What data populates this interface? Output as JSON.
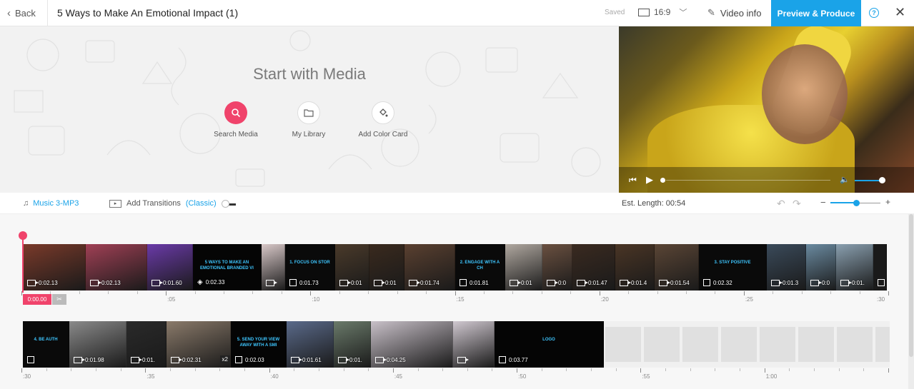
{
  "header": {
    "back_label": "Back",
    "title": "5 Ways to Make An Emotional Impact (1)",
    "saved_label": "Saved",
    "ratio_label": "16:9",
    "video_info_label": "Video info",
    "preview_label": "Preview & Produce",
    "help_icon": "?",
    "close_icon": "✕"
  },
  "media": {
    "title": "Start with Media",
    "options": [
      {
        "label": "Search Media",
        "icon": "search-icon"
      },
      {
        "label": "My Library",
        "icon": "folder-icon"
      },
      {
        "label": "Add Color Card",
        "icon": "paint-bucket-icon"
      }
    ]
  },
  "player": {
    "prev_icon": "⏮",
    "play_icon": "▶",
    "volume_icon": "🔈"
  },
  "toolbar": {
    "music_label": "Music 3-MP3",
    "transitions_label": "Add Transitions",
    "transitions_mode": "(Classic)",
    "est_length": "Est. Length: 00:54",
    "undo_icon": "↶",
    "redo_icon": "↷",
    "zoom_minus": "−",
    "zoom_plus": "+"
  },
  "playhead": {
    "time": "0:00.00"
  },
  "row1_clips": [
    {
      "kind": "video",
      "dur": "0:02.13",
      "bg": "#7a3a2a",
      "w": 88
    },
    {
      "kind": "video",
      "dur": "0:02.13",
      "bg": "#a04055",
      "w": 86
    },
    {
      "kind": "video",
      "dur": "0:01.60",
      "bg": "#6a3aa8",
      "w": 64
    },
    {
      "kind": "color",
      "dur": "0:02.33",
      "bg": "#050505",
      "w": 96,
      "headline": "5 WAYS TO MAKE AN EMOTIONAL BRANDED VI"
    },
    {
      "kind": "video",
      "dur": "",
      "bg": "#d8c8c8",
      "w": 33
    },
    {
      "kind": "image",
      "dur": "0:01.73",
      "bg": "#0a0a0a",
      "w": 70,
      "headline": "1. FOCUS ON STOR"
    },
    {
      "kind": "video",
      "dur": "0:01",
      "bg": "#4a3a2a",
      "w": 48
    },
    {
      "kind": "video",
      "dur": "0:01",
      "bg": "#3a2a1e",
      "w": 49
    },
    {
      "kind": "video",
      "dur": "0:01.74",
      "bg": "#5a4030",
      "w": 71
    },
    {
      "kind": "image",
      "dur": "0:01.81",
      "bg": "#0a0a0a",
      "w": 70,
      "headline": "2. ENGAGE WITH A CH"
    },
    {
      "kind": "video",
      "dur": "0:01",
      "bg": "#b0a8a0",
      "w": 52
    },
    {
      "kind": "video",
      "dur": "0:0",
      "bg": "#6a5040",
      "w": 42
    },
    {
      "kind": "video",
      "dur": "0:01.47",
      "bg": "#3a2a20",
      "w": 60
    },
    {
      "kind": "video",
      "dur": "0:01.4",
      "bg": "#4a3525",
      "w": 55
    },
    {
      "kind": "video",
      "dur": "0:01.54",
      "bg": "#5a4535",
      "w": 62
    },
    {
      "kind": "image",
      "dur": "0:02.32",
      "bg": "#0a0a0a",
      "w": 95,
      "headline": "3. STAY POSITIVE"
    },
    {
      "kind": "video",
      "dur": "0:01.3",
      "bg": "#3a4a5a",
      "w": 55
    },
    {
      "kind": "video",
      "dur": "0:0",
      "bg": "#6a8aa0",
      "w": 42
    },
    {
      "kind": "video",
      "dur": "0:01.",
      "bg": "#8aa0b0",
      "w": 52
    },
    {
      "kind": "image",
      "dur": "",
      "bg": "#1a1a1a",
      "w": 19
    }
  ],
  "row2_clips": [
    {
      "kind": "image",
      "dur": "",
      "bg": "#0a0a0a",
      "w": 65,
      "headline": "4. BE AUTH"
    },
    {
      "kind": "video",
      "dur": "0:01.98",
      "bg": "#8a8a8a",
      "w": 80
    },
    {
      "kind": "video",
      "dur": "0:01.",
      "bg": "#2a2a2a",
      "w": 56
    },
    {
      "kind": "video",
      "dur": "0:02.31",
      "bg": "#8a7a6a",
      "w": 90,
      "x2": "x2"
    },
    {
      "kind": "image",
      "dur": "0:02.03",
      "bg": "#050505",
      "w": 78,
      "headline": "5. SEND YOUR VIEW AWAY WITH A SMI"
    },
    {
      "kind": "video",
      "dur": "0:01.61",
      "bg": "#5a6a8a",
      "w": 66
    },
    {
      "kind": "video",
      "dur": "0:01.",
      "bg": "#6a7a6a",
      "w": 52
    },
    {
      "kind": "video",
      "dur": "0:04.25",
      "bg": "#c8c0c8",
      "w": 115
    },
    {
      "kind": "video",
      "dur": "",
      "bg": "#d0c8d0",
      "w": 58
    },
    {
      "kind": "image",
      "dur": "0:03.77",
      "bg": "#050505",
      "w": 153,
      "headline": "LOGO"
    }
  ],
  "ruler1": [
    ":05",
    ":10",
    ":15",
    ":20",
    ":25",
    ":30"
  ],
  "ruler2": [
    ":30",
    ":35",
    ":40",
    ":45",
    ":50",
    ":55",
    "1:00"
  ],
  "colors": {
    "accent": "#1aa3e8",
    "playhead": "#f0436b"
  }
}
